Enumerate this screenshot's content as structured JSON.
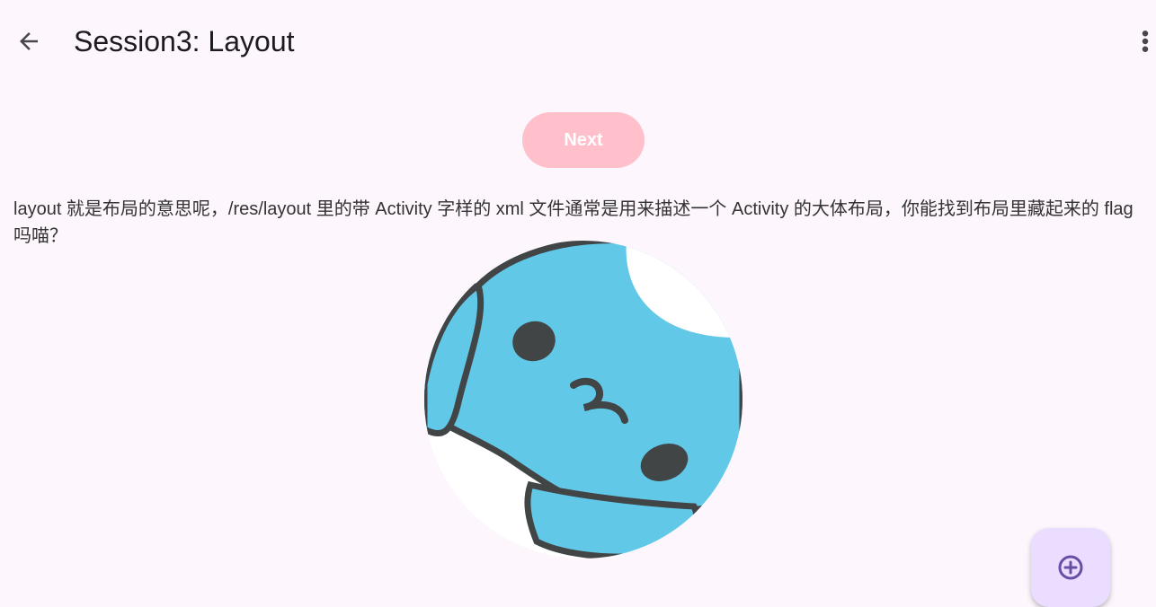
{
  "app_bar": {
    "title": "Session3: Layout",
    "back_icon": "arrow-back-icon",
    "menu_icon": "more-vert-icon"
  },
  "main": {
    "next_label": "Next",
    "description": "layout 就是布局的意思呢，/res/layout 里的带 Activity 字样的 xml 文件通常是用来描述一个 Activity 的大体布局，你能找到布局里藏起来的 flag 吗喵？",
    "image": "blue-cat-mascot"
  },
  "fab": {
    "icon": "add-circle-icon"
  },
  "colors": {
    "background": "#fdf6fd",
    "next_button": "#ffc0cb",
    "mascot_blue": "#62c8e8",
    "fab": "#eaddff",
    "fab_icon": "#6750a4"
  }
}
